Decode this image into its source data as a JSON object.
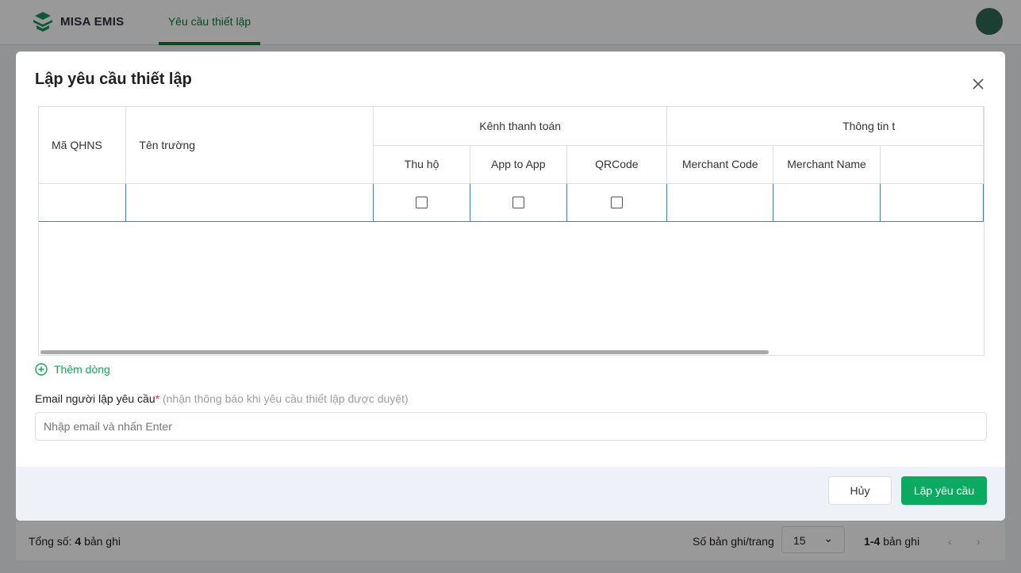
{
  "app": {
    "logo_text": "MISA EMIS",
    "nav_tab": "Yêu cầu thiết lập"
  },
  "pagebar": {
    "total_label": "Tổng số:",
    "total_value": "4",
    "total_unit": "bản ghi",
    "per_page_label": "Số bản ghi/trang",
    "per_page_value": "15",
    "range_bold": "1-4",
    "range_unit": "bản ghi"
  },
  "modal": {
    "title": "Lập yêu cầu thiết lập",
    "table": {
      "col_ma": "Mã QHNS",
      "col_ten": "Tên trường",
      "group_kenh": "Kênh thanh toán",
      "group_thongtin": "Thông tin t",
      "sub": [
        "Thu hộ",
        "App to App",
        "QRCode",
        "Merchant Code",
        "Merchant Name"
      ]
    },
    "add_row": "Thêm dòng",
    "email_label": "Email người lập yêu cầu",
    "email_required": "*",
    "email_hint": "(nhận thông báo khi yêu cầu thiết lập được duyệt)",
    "email_placeholder": "Nhập email và nhấn Enter",
    "cancel": "Hủy",
    "submit": "Lập yêu cầu"
  }
}
